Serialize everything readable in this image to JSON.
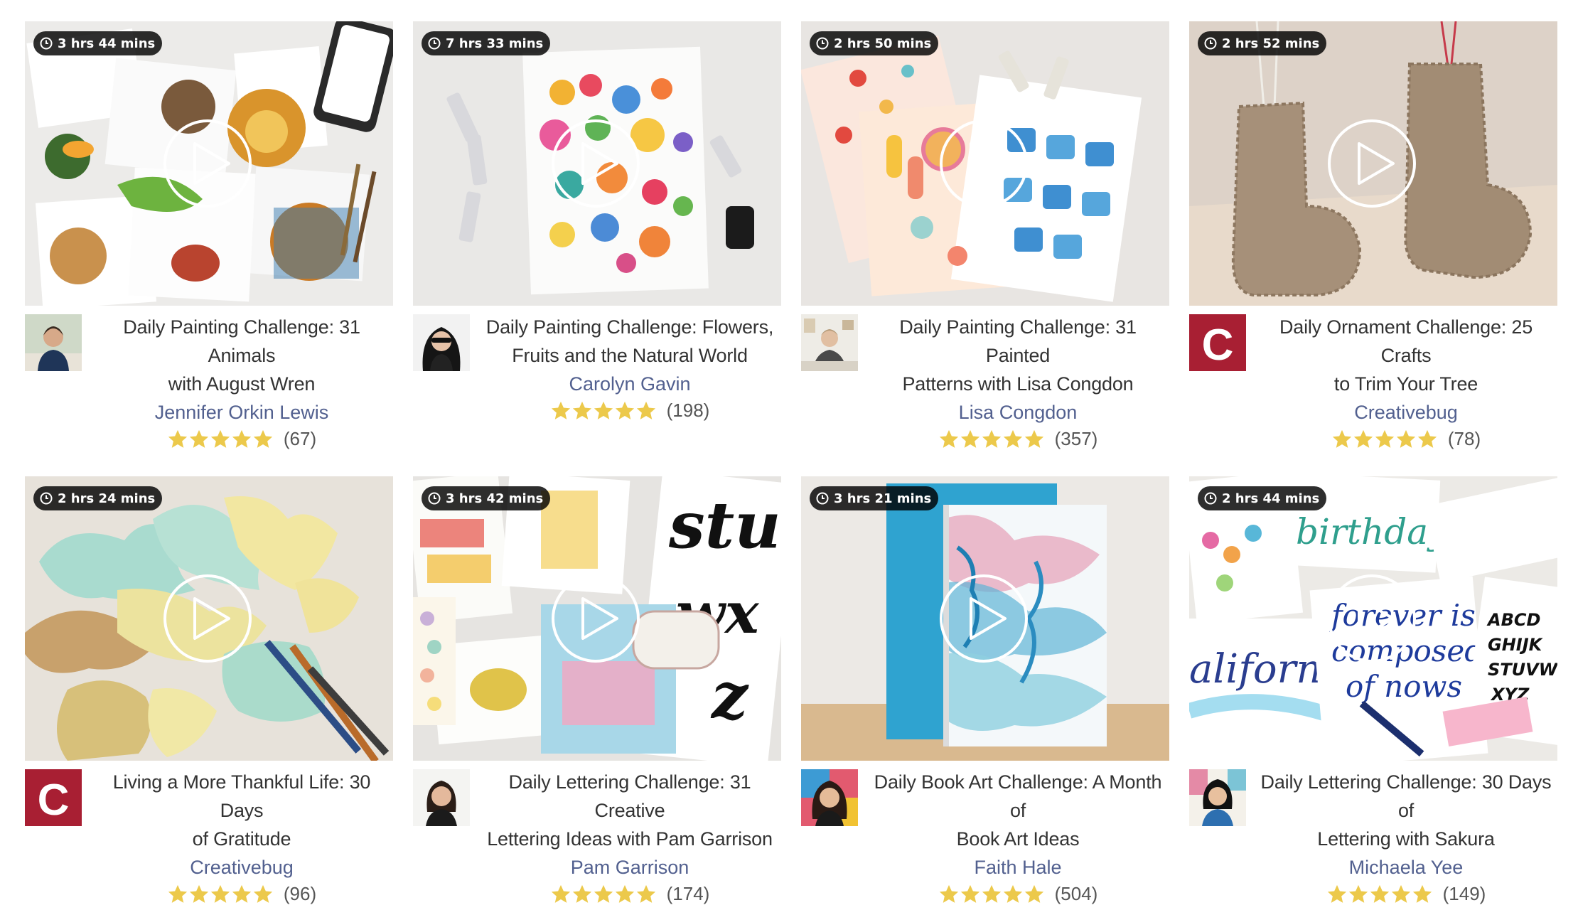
{
  "theme": {
    "star_color": "#ecc94b",
    "author_color": "#52608f",
    "badge_bg": "#111111",
    "brand_red": "#a81f33"
  },
  "icons": {
    "clock": "clock-icon",
    "play": "play-icon",
    "star": "star-icon",
    "brand_logo": "creativebug-logo"
  },
  "courses": [
    {
      "duration": "3 hrs 44 mins",
      "title_line1": "Daily Painting Challenge: 31 Animals",
      "title_line2": "with August Wren",
      "author": "Jennifer Orkin Lewis",
      "rating_count": "(67)",
      "stars": 5,
      "avatar": "photo"
    },
    {
      "duration": "7 hrs 33 mins",
      "title_line1": "Daily Painting Challenge: Flowers,",
      "title_line2": "Fruits and the Natural World",
      "author": "Carolyn Gavin",
      "rating_count": "(198)",
      "stars": 5,
      "avatar": "photo"
    },
    {
      "duration": "2 hrs 50 mins",
      "title_line1": "Daily Painting Challenge: 31 Painted",
      "title_line2": "Patterns with Lisa Congdon",
      "author": "Lisa Congdon",
      "rating_count": "(357)",
      "stars": 5,
      "avatar": "photo"
    },
    {
      "duration": "2 hrs 52 mins",
      "title_line1": "Daily Ornament Challenge: 25 Crafts",
      "title_line2": "to Trim Your Tree",
      "author": "Creativebug",
      "rating_count": "(78)",
      "stars": 5,
      "avatar": "brand",
      "logo_letter": "C"
    },
    {
      "duration": "2 hrs 24 mins",
      "title_line1": "Living a More Thankful Life: 30 Days",
      "title_line2": "of Gratitude",
      "author": "Creativebug",
      "rating_count": "(96)",
      "stars": 5,
      "avatar": "brand",
      "logo_letter": "C"
    },
    {
      "duration": "3 hrs 42 mins",
      "title_line1": "Daily Lettering Challenge: 31 Creative",
      "title_line2": "Lettering Ideas with Pam Garrison",
      "author": "Pam Garrison",
      "rating_count": "(174)",
      "stars": 5,
      "avatar": "photo"
    },
    {
      "duration": "3 hrs 21 mins",
      "title_line1": "Daily Book Art Challenge: A Month of",
      "title_line2": "Book Art Ideas",
      "author": "Faith Hale",
      "rating_count": "(504)",
      "stars": 5,
      "avatar": "photo"
    },
    {
      "duration": "2 hrs 44 mins",
      "title_line1": "Daily Lettering Challenge: 30 Days of",
      "title_line2": "Lettering with Sakura",
      "author": "Michaela Yee",
      "rating_count": "(149)",
      "stars": 5,
      "avatar": "photo"
    }
  ]
}
